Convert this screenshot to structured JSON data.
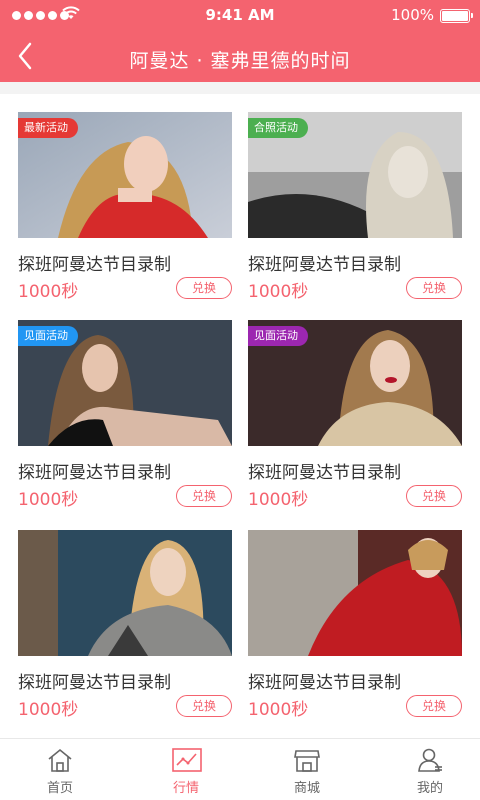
{
  "status_bar": {
    "time": "9:41 AM",
    "battery": "100%"
  },
  "header": {
    "title": "阿曼达 · 塞弗里德的时间"
  },
  "cards": [
    {
      "tag": "最新活动",
      "tag_color": "#e53935",
      "title": "探班阿曼达节目录制",
      "price": "1000秒",
      "button": "兑换"
    },
    {
      "tag": "合照活动",
      "tag_color": "#4caf50",
      "title": "探班阿曼达节目录制",
      "price": "1000秒",
      "button": "兑换"
    },
    {
      "tag": "见面活动",
      "tag_color": "#2196f3",
      "title": "探班阿曼达节目录制",
      "price": "1000秒",
      "button": "兑换"
    },
    {
      "tag": "见面活动",
      "tag_color": "#9c27b0",
      "title": "探班阿曼达节目录制",
      "price": "1000秒",
      "button": "兑换"
    },
    {
      "tag": "",
      "tag_color": "",
      "title": "探班阿曼达节目录制",
      "price": "1000秒",
      "button": "兑换"
    },
    {
      "tag": "",
      "tag_color": "",
      "title": "探班阿曼达节目录制",
      "price": "1000秒",
      "button": "兑换"
    }
  ],
  "tabbar": {
    "items": [
      {
        "label": "首页",
        "icon": "home-icon",
        "active": false
      },
      {
        "label": "行情",
        "icon": "chart-icon",
        "active": true
      },
      {
        "label": "商城",
        "icon": "store-icon",
        "active": false
      },
      {
        "label": "我的",
        "icon": "user-icon",
        "active": false
      }
    ]
  },
  "colors": {
    "accent": "#f4636f"
  }
}
